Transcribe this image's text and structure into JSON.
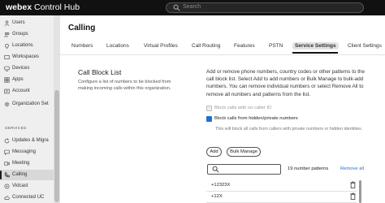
{
  "topbar": {
    "brand_bold": "webex",
    "brand_rest": "Control Hub",
    "search_placeholder": "Search"
  },
  "sidebar": {
    "items": [
      {
        "label": "Users",
        "icon": "user-icon"
      },
      {
        "label": "Groups",
        "icon": "group-icon"
      },
      {
        "label": "Locations",
        "icon": "location-icon"
      },
      {
        "label": "Workspaces",
        "icon": "workspace-icon"
      },
      {
        "label": "Devices",
        "icon": "device-icon"
      },
      {
        "label": "Apps",
        "icon": "apps-icon"
      },
      {
        "label": "Account",
        "icon": "account-icon"
      },
      {
        "label": "Organization Set",
        "icon": "gear-icon"
      }
    ],
    "section_label": "SERVICES",
    "services": [
      {
        "label": "Updates & Migra",
        "icon": "refresh-icon"
      },
      {
        "label": "Messaging",
        "icon": "message-icon"
      },
      {
        "label": "Meeting",
        "icon": "meeting-icon"
      },
      {
        "label": "Calling",
        "icon": "phone-icon",
        "active": true
      },
      {
        "label": "Vidcast",
        "icon": "vidcast-icon"
      },
      {
        "label": "Connected UC",
        "icon": "cloud-icon"
      }
    ]
  },
  "page": {
    "title": "Calling",
    "tabs": [
      "Numbers",
      "Locations",
      "Virtual Profiles",
      "Call Routing",
      "Features",
      "PSTN",
      "Service Settings",
      "Client Settings"
    ],
    "active_tab": "Service Settings"
  },
  "call_block": {
    "title": "Call Block List",
    "description": "Configure a list of numbers to be blocked from making incoming calls within this organization.",
    "intro": "Add or remove phone numbers, country codes or other patterns to the call block list. Select Add to add numbers or Bulk Manage to bulk-add numbers. You can remove individual numbers or select Remove All to remove all numbers and patterns from the list.",
    "block_no_caller_id_label": "Block calls with no caller ID",
    "block_no_caller_id_checked": false,
    "block_private_label": "Block calls from hidden/private numbers",
    "block_private_checked": true,
    "private_note": "This will block all calls from callers with private numbers or hidden identities.",
    "add_label": "Add",
    "bulk_manage_label": "Bulk Manage",
    "pattern_count": "19 number patterns",
    "remove_all_label": "Remove all",
    "numbers": [
      "+12323X",
      "+12X"
    ]
  }
}
